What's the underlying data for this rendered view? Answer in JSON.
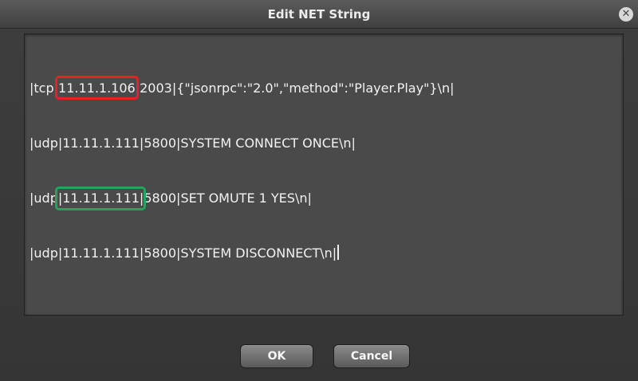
{
  "window": {
    "title": "Edit NET String",
    "close_glyph": "✕"
  },
  "editor": {
    "lines": [
      {
        "pre": "|tcp|",
        "highlight": "11.11.1.106",
        "post": "|2003|{\"jsonrpc\":\"2.0\",\"method\":\"Player.Play\"}\\n|"
      },
      {
        "pre": "|udp|11.11.1.111|5800|SYSTEM CONNECT ONCE\\n|"
      },
      {
        "pre": "|udp",
        "highlight": "|11.11.1.111|",
        "post": "5800|SET OMUTE 1 YES\\n|"
      },
      {
        "pre": "|udp|11.11.1.111|5800|SYSTEM DISCONNECT\\n|"
      }
    ],
    "highlight_colors": {
      "red": "#e8202a",
      "green": "#21a65a"
    }
  },
  "buttons": {
    "ok_label": "OK",
    "cancel_label": "Cancel"
  },
  "icons": {
    "close": "close-icon"
  }
}
